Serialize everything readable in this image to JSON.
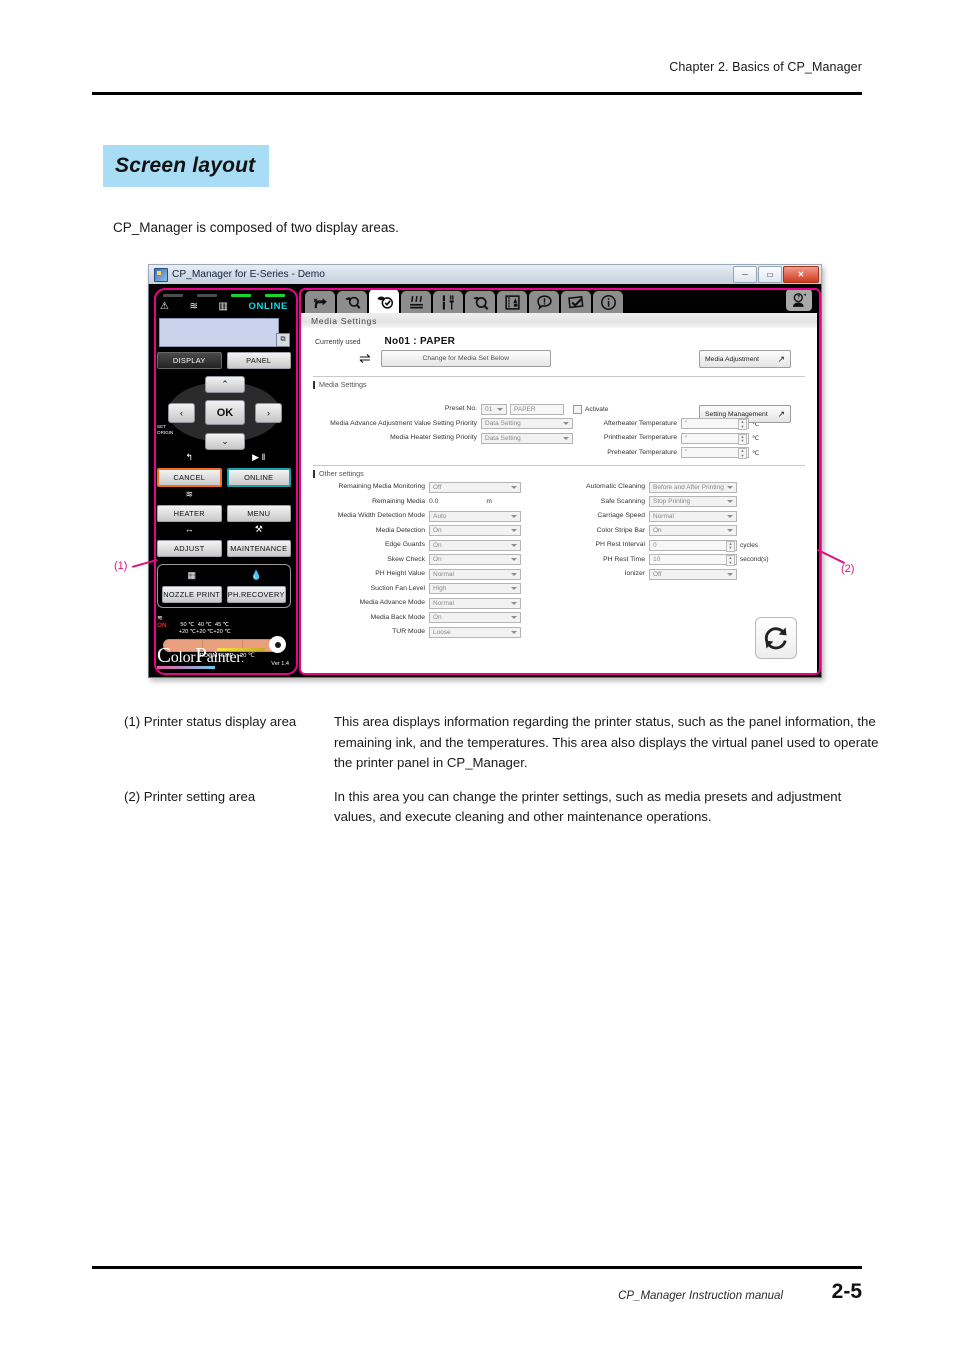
{
  "page": {
    "header": "Chapter 2. Basics of CP_Manager",
    "section_title": "Screen layout",
    "intro": "CP_Manager is composed of two display areas.",
    "footer_text": "CP_Manager Instruction manual",
    "footer_page": "2-5",
    "highlight_color": "#a9ddf5",
    "callout_color": "#ec008c"
  },
  "callouts": [
    {
      "id": "callout-1",
      "label": "(1)"
    },
    {
      "id": "callout-2",
      "label": "(2)"
    }
  ],
  "descriptions": [
    {
      "term": "(1) Printer status display area",
      "definition": "This area displays information regarding the printer status, such as the panel information, the remaining ink, and the temperatures. This area also displays the virtual panel used to operate the printer panel in CP_Manager."
    },
    {
      "term": "(2) Printer setting area",
      "definition": "In this area you can change the printer settings, such as media presets and adjustment values, and execute cleaning and other maintenance operations."
    }
  ],
  "app": {
    "titlebar": {
      "title": "CP_Manager for E-Series - Demo",
      "minimize": "─",
      "maximize": "▭",
      "close": "✕"
    },
    "status_panel": {
      "icons": [
        "warning-icon",
        "heater-icon",
        "ink-icon"
      ],
      "online_label": "ONLINE",
      "display_button": "DISPLAY",
      "panel_button": "PANEL",
      "ok_button": "OK",
      "set_origin_label": "SET\nORIGIN",
      "arrow_up": "⌃",
      "arrow_down": "⌄",
      "arrow_left": "‹",
      "arrow_right": "›",
      "cancel_glyph": "↰",
      "online_glyph": "▶ ‖",
      "cancel_button": "CANCEL",
      "online_button": "ONLINE",
      "heater_button": "HEATER",
      "menu_button": "MENU",
      "adjust_glyph": "↔",
      "maintenance_glyph": "⚒",
      "adjust_button": "ADJUST",
      "maintenance_button": "MAINTENANCE",
      "nozzle_print_button": "NOZZLE PRINT",
      "ph_recovery_button": "PH.RECOVERY",
      "heater_on_label": "ON",
      "temps": [
        {
          "target": "50 ℃",
          "offset": "+20 ℃"
        },
        {
          "target": "40 ℃",
          "offset": "+20 ℃"
        },
        {
          "target": "45 ℃",
          "offset": "+20 ℃"
        }
      ],
      "roomtemp_label": "ROOMTEMP",
      "roomtemp_value": "20 ℃",
      "logo_color": "Color",
      "logo_painter": "Painter.",
      "version": "Ver 1.4"
    },
    "toolbar": {
      "tabs": [
        {
          "name": "tab-media-load",
          "icon": "hand-media-icon",
          "active": false
        },
        {
          "name": "tab-print-check",
          "icon": "magnifier-print-icon",
          "active": false
        },
        {
          "name": "tab-media-settings",
          "icon": "media-settings-icon",
          "active": true
        },
        {
          "name": "tab-heater",
          "icon": "heater-icon",
          "active": false
        },
        {
          "name": "tab-maintenance",
          "icon": "wrench-brush-icon",
          "active": false
        },
        {
          "name": "tab-nozzle-check",
          "icon": "nozzle-magnifier-icon",
          "active": false
        },
        {
          "name": "tab-ink",
          "icon": "ink-bottle-icon",
          "active": false
        },
        {
          "name": "tab-alerts",
          "icon": "alert-balloon-icon",
          "active": false
        },
        {
          "name": "tab-checklist",
          "icon": "check-flag-icon",
          "active": false
        },
        {
          "name": "tab-information",
          "icon": "info-circle-icon",
          "active": false
        }
      ],
      "help_icon": "help-person-icon"
    },
    "content": {
      "panel_title": "Media Settings",
      "currently_used_label": "Currently used",
      "currently_used_value": "No01 : PAPER",
      "swap_icon": "swap-arrows-icon",
      "change_media_button": "Change for Media Set Below",
      "media_adjustment_button": "Media Adjustment",
      "media_adjustment_icon": "external-link-icon",
      "media_settings_group": "Media Settings",
      "setting_management_button": "Setting Management",
      "setting_management_icon": "external-link-icon",
      "preset_no_label": "Preset No.",
      "preset_no_value": "01",
      "preset_name_value": "PAPER",
      "activate_label": "Activate",
      "media_settings_left": [
        {
          "label": "Media Advance Adjustment Value Setting Priority",
          "value": "Data Setting",
          "type": "select"
        },
        {
          "label": "Media Heater Setting Priority",
          "value": "Data Setting",
          "type": "select"
        }
      ],
      "media_settings_right": [
        {
          "label": "Afterheater Temperature",
          "value": "\"",
          "unit": "℃",
          "type": "spinner"
        },
        {
          "label": "Printheater Temperature",
          "value": "\"",
          "unit": "℃",
          "type": "spinner"
        },
        {
          "label": "Preheater Temperature",
          "value": "\"",
          "unit": "℃",
          "type": "spinner"
        }
      ],
      "other_settings_group": "Other settings",
      "other_left": [
        {
          "label": "Remaining Media Monitoring",
          "value": "Off",
          "type": "select"
        },
        {
          "label": "Remaining Media",
          "value": "0.0",
          "unit": "m",
          "type": "text"
        },
        {
          "label": "Media Width Detection Mode",
          "value": "Auto",
          "type": "select"
        },
        {
          "label": "Media Detection",
          "value": "On",
          "type": "select"
        },
        {
          "label": "Edge Guards",
          "value": "On",
          "type": "select"
        },
        {
          "label": "Skew Check",
          "value": "On",
          "type": "select"
        },
        {
          "label": "PH Height Value",
          "value": "Normal",
          "type": "select"
        },
        {
          "label": "Suction Fan Level",
          "value": "High",
          "type": "select"
        },
        {
          "label": "Media Advance Mode",
          "value": "Normal",
          "type": "select"
        },
        {
          "label": "Media Back Mode",
          "value": "On",
          "type": "select"
        },
        {
          "label": "TUR Mode",
          "value": "Loose",
          "type": "select"
        }
      ],
      "other_right": [
        {
          "label": "Automatic Cleaning",
          "value": "Before and After Printing",
          "unit": "",
          "type": "select"
        },
        {
          "label": "Safe Scanning",
          "value": "Stop Printing",
          "unit": "",
          "type": "select"
        },
        {
          "label": "Carriage Speed",
          "value": "Normal",
          "unit": "",
          "type": "select"
        },
        {
          "label": "Color Stripe Bar",
          "value": "On",
          "unit": "",
          "type": "select"
        },
        {
          "label": "PH Rest Interval",
          "value": "0",
          "unit": "cycles",
          "type": "spinner"
        },
        {
          "label": "PH Rest Time",
          "value": "10",
          "unit": "second(s)",
          "type": "spinner"
        },
        {
          "label": "Ionizer",
          "value": "Off",
          "unit": "",
          "type": "select"
        }
      ],
      "refresh_icon": "refresh-circular-icon"
    }
  }
}
